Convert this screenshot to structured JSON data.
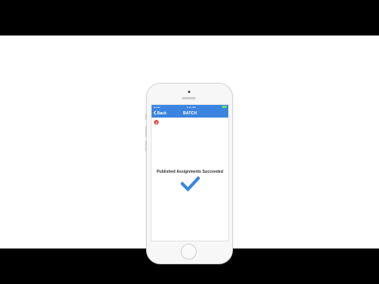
{
  "status_bar": {
    "carrier": "Carrier",
    "time": "9:41 AM"
  },
  "nav": {
    "back_label": "Back",
    "title": "BATCH"
  },
  "badge": {
    "count": "3"
  },
  "main": {
    "message": "Published Assignments Succeeded"
  },
  "colors": {
    "nav_blue": "#3b84e0",
    "check_blue": "#3b84e0",
    "badge_red": "#e04848"
  },
  "icons": {
    "back": "chevron-left-icon",
    "success": "checkmark-icon",
    "battery": "battery-icon"
  }
}
